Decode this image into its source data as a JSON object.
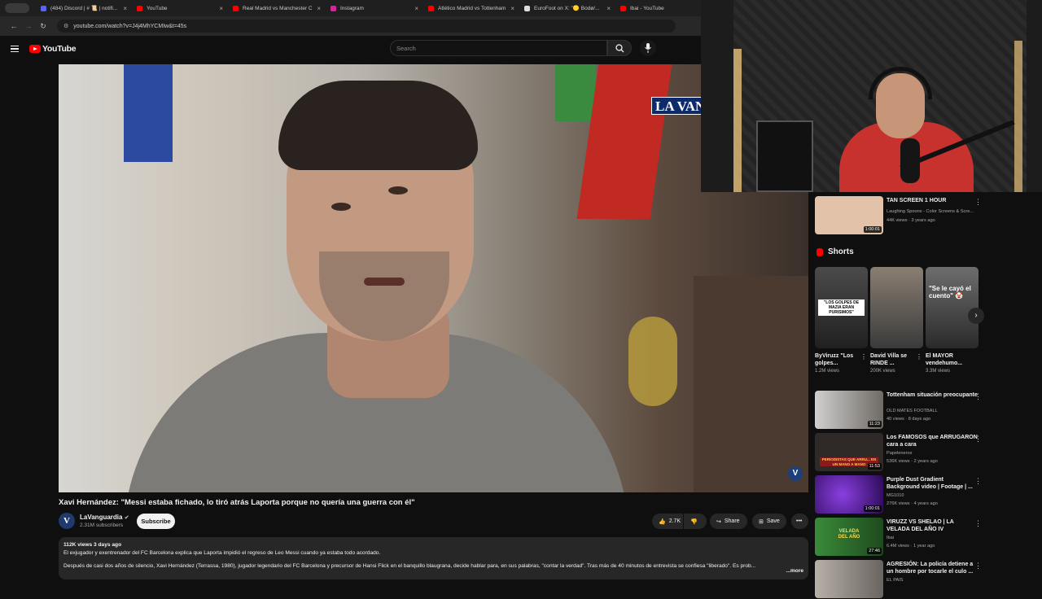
{
  "browser": {
    "tabs": [
      {
        "title": "(484) Discord | # 📜 | notifi...",
        "color": "#5865f2"
      },
      {
        "title": "YouTube",
        "color": "#ff0000"
      },
      {
        "title": "Real Madrid vs Manchester C...",
        "color": "#ff0000"
      },
      {
        "title": "Instagram",
        "color": "#d6249f"
      },
      {
        "title": "Atlético Madrid vs Tottenham...",
        "color": "#ff0000"
      },
      {
        "title": "EuroFoot on X: \"🟡 Bodø/...",
        "color": "#dddddd"
      },
      {
        "title": "Ibai - YouTube",
        "color": "#ff0000"
      }
    ],
    "url": "youtube.com/watch?v=J4j4MhYCMIw&t=45s"
  },
  "header": {
    "logo_text": "YouTube",
    "search_placeholder": "Search"
  },
  "video": {
    "overlay_text": "LA VAN",
    "watermark": "V",
    "title": "Xavi Hernández: \"Messi estaba fichado, lo tiró atrás Laporta porque no quería una guerra con él\"",
    "channel": "LaVanguardia",
    "channel_initial": "V",
    "subscribers": "2.31M subscribers",
    "subscribe_label": "Subscribe",
    "likes": "2.7K",
    "share_label": "Share",
    "save_label": "Save",
    "meta": "112K views  3 days ago",
    "desc_line1": "El exjugador y exentrenador del FC Barcelona explica que Laporta impidió el regreso de Leo Messi cuando ya estaba todo acordado.",
    "desc_line2": "Después de casi dos años de silencio, Xavi Hernández (Terrassa, 1980), jugador legendario del FC Barcelona y precursor de Hansi Flick en el banquillo blaugrana, decide hablar para, en sus palabras, \"contar la verdad\". Tras más de 40 minutos de entrevista se confiesa \"liberado\". Es prob...",
    "more_label": "...more"
  },
  "sidebar": {
    "top": {
      "title": "TAN SCREEN 1 HOUR",
      "channel": "Laughing Spoons - Color Screens & Scre...",
      "meta": "44K views · 3 years ago",
      "duration": "1:00:01",
      "color": "#e2c2a8"
    },
    "shorts_heading": "Shorts",
    "shorts": [
      {
        "title": "ByViruzz \"Los golpes...",
        "views": "1.2M views",
        "caption": "\"LOS GOLPES DE MAZIA ERAN PURISIMOS\"",
        "color": "#3b3b3b"
      },
      {
        "title": "David Villa se RINDE ...",
        "views": "200K views",
        "caption": "",
        "color": "#8a7e72"
      },
      {
        "title": "El MAYOR vendehumo...",
        "views": "3.3M views",
        "caption": "\"Se le cayó el cuento\" 🤡",
        "color": "#6d6d6d"
      }
    ],
    "videos": [
      {
        "title": "Tottenham situación preocupante",
        "channel": "OLD MATES FOOTBALL",
        "meta": "40 views · 8 days ago",
        "duration": "11:23",
        "color": "#6f6a64"
      },
      {
        "title": "Los FAMOSOS que ARRUGARON cara a cara",
        "channel": "Papeleneros",
        "meta": "536K views · 2 years ago",
        "duration": "11:53",
        "color": "#2f2a28",
        "caption": "PERIODISTAS QUE ARRU... EN UN MANO A MANO"
      },
      {
        "title": "Purple Dust Gradient Background video | Footage | ...",
        "channel": "MG1010",
        "meta": "276K views · 4 years ago",
        "duration": "1:00:01",
        "color": "#5b18a8"
      },
      {
        "title": "VIRUZZ VS SHELAO | LA VELADA DEL AÑO IV",
        "channel": "Ibai",
        "meta": "6.4M views · 1 year ago",
        "duration": "27:46",
        "color": "#2a6a2a",
        "caption": "VELADA DEL AÑO"
      },
      {
        "title": "AGRESIÓN: La policía detiene a un hombre por tocarle el culo ...",
        "channel": "EL PAÍS",
        "meta": "",
        "duration": "",
        "color": "#8a8480"
      }
    ]
  }
}
